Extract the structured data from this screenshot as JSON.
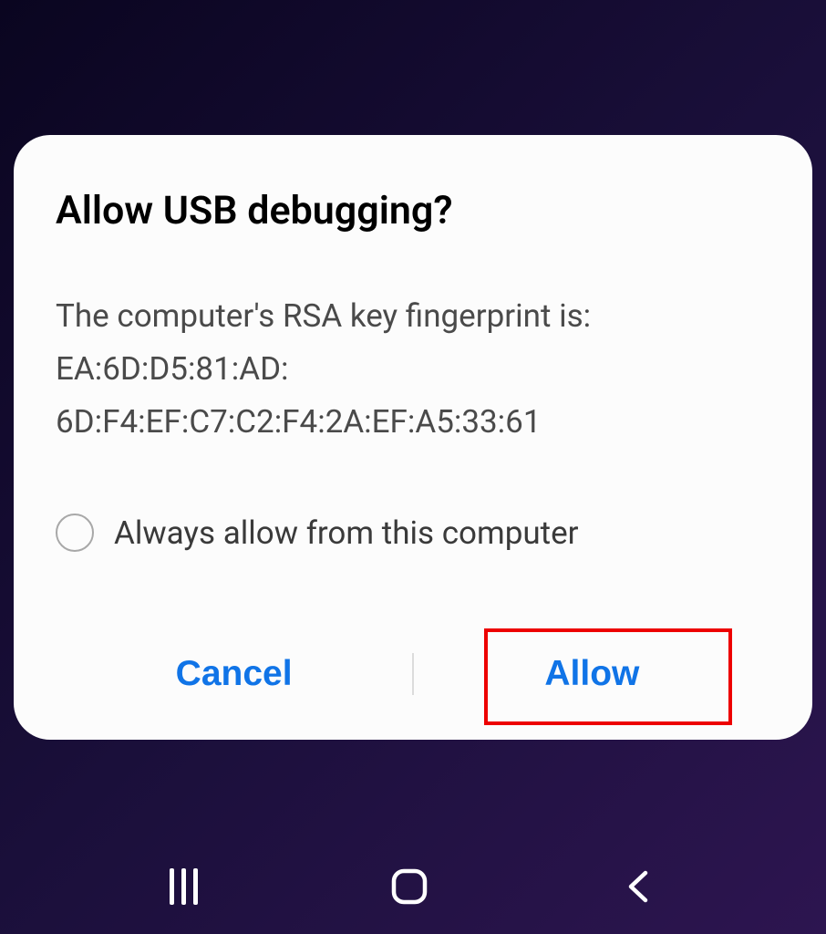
{
  "dialog": {
    "title": "Allow USB debugging?",
    "message_line1": "The computer's RSA key fingerprint is:",
    "message_line2": "EA:6D:D5:81:AD:",
    "message_line3": "6D:F4:EF:C7:C2:F4:2A:EF:A5:33:61",
    "checkbox_label": "Always allow from this computer",
    "cancel_label": "Cancel",
    "allow_label": "Allow"
  }
}
